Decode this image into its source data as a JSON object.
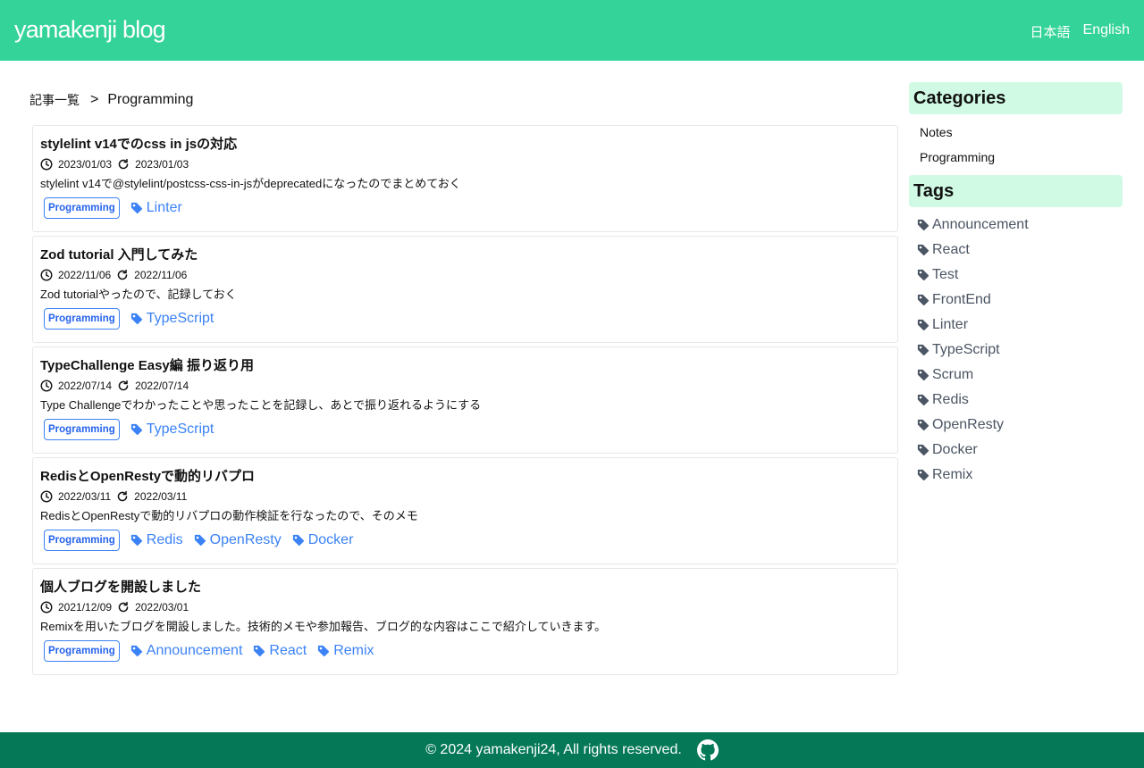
{
  "header": {
    "site_title": "yamakenji blog",
    "languages": [
      "日本語",
      "English"
    ]
  },
  "breadcrumb": {
    "root": "記事一覧",
    "separator": ">",
    "current": "Programming"
  },
  "posts": [
    {
      "title": "stylelint v14でのcss in jsの対応",
      "created": "2023/01/03",
      "updated": "2023/01/03",
      "description": "stylelint v14で@stylelint/postcss-css-in-jsがdeprecatedになったのでまとめておく",
      "category": "Programming",
      "tags": [
        "Linter"
      ]
    },
    {
      "title": "Zod tutorial 入門してみた",
      "created": "2022/11/06",
      "updated": "2022/11/06",
      "description": "Zod tutorialやったので、記録しておく",
      "category": "Programming",
      "tags": [
        "TypeScript"
      ]
    },
    {
      "title": "TypeChallenge Easy編 振り返り用",
      "created": "2022/07/14",
      "updated": "2022/07/14",
      "description": "Type Challengeでわかったことや思ったことを記録し、あとで振り返れるようにする",
      "category": "Programming",
      "tags": [
        "TypeScript"
      ]
    },
    {
      "title": "RedisとOpenRestyで動的リバプロ",
      "created": "2022/03/11",
      "updated": "2022/03/11",
      "description": "RedisとOpenRestyで動的リバプロの動作検証を行なったので、そのメモ",
      "category": "Programming",
      "tags": [
        "Redis",
        "OpenResty",
        "Docker"
      ]
    },
    {
      "title": "個人ブログを開設しました",
      "created": "2021/12/09",
      "updated": "2022/03/01",
      "description": "Remixを用いたブログを開設しました。技術的メモや参加報告、ブログ的な内容はここで紹介していきます。",
      "category": "Programming",
      "tags": [
        "Announcement",
        "React",
        "Remix"
      ]
    }
  ],
  "sidebar": {
    "categories_heading": "Categories",
    "categories": [
      "Notes",
      "Programming"
    ],
    "tags_heading": "Tags",
    "tags": [
      "Announcement",
      "React",
      "Test",
      "FrontEnd",
      "Linter",
      "TypeScript",
      "Scrum",
      "Redis",
      "OpenResty",
      "Docker",
      "Remix"
    ]
  },
  "footer": {
    "copyright": "© 2024 yamakenji24, All rights reserved.",
    "github_icon": "github-icon"
  },
  "colors": {
    "header_bg": "#34d399",
    "footer_bg": "#047857",
    "sidebar_heading_bg": "#d1fae5",
    "link_blue": "#3b82f6",
    "tag_gray": "#4b5563"
  },
  "icons": {
    "created": "clock-icon",
    "updated": "refresh-icon",
    "tag": "tag-icon"
  }
}
